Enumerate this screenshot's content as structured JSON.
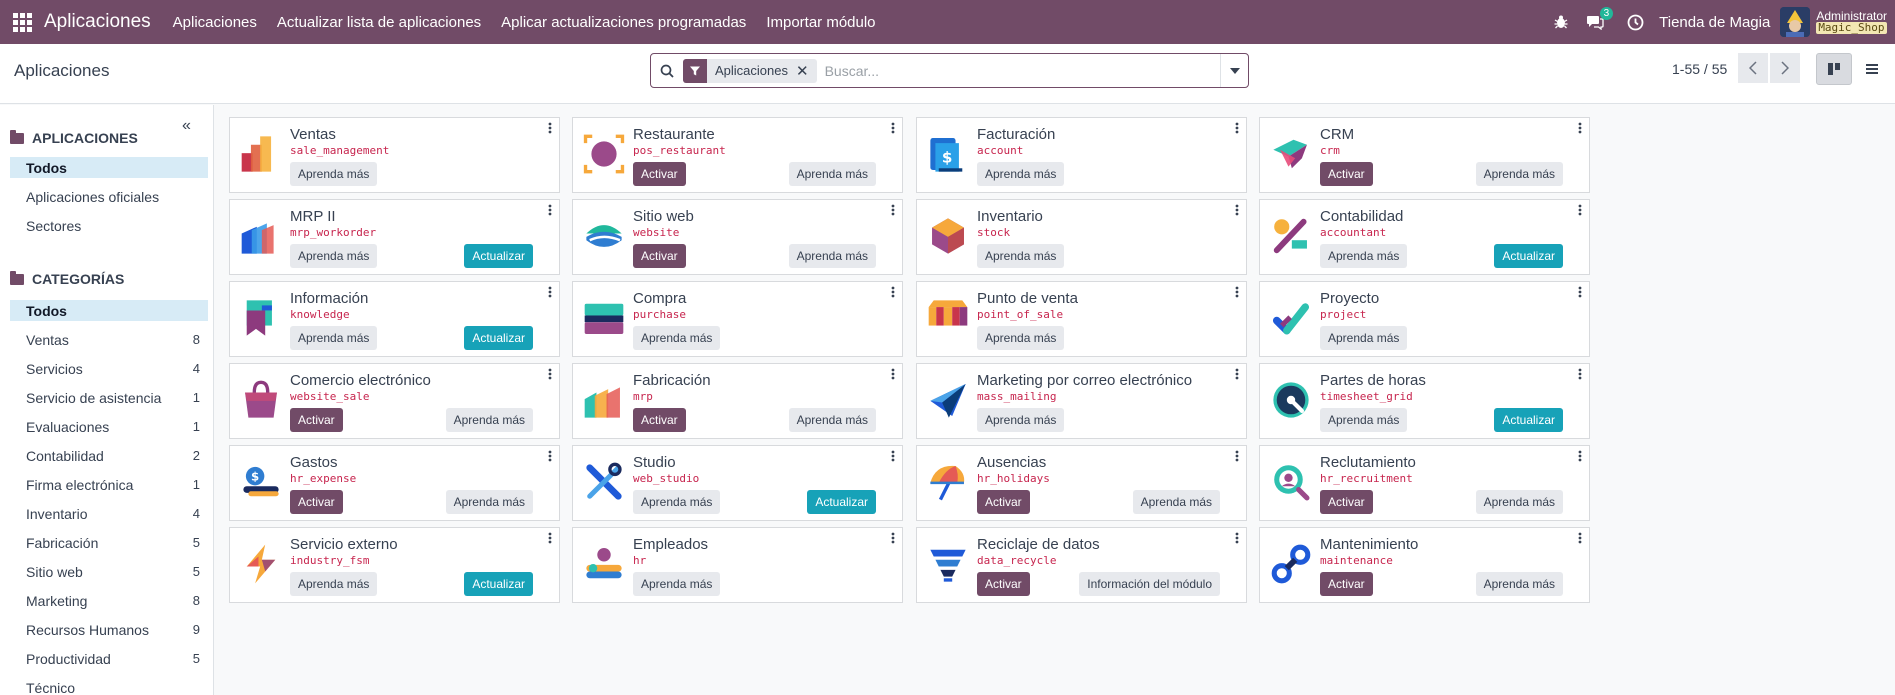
{
  "navbar": {
    "brand": "Aplicaciones",
    "menus": [
      "Aplicaciones",
      "Actualizar lista de aplicaciones",
      "Aplicar actualizaciones programadas",
      "Importar módulo"
    ],
    "chat_badge": "3",
    "company": "Tienda de Magia",
    "user": "Administrator",
    "database": "Magic_Shop",
    "icons": [
      "apps-grid-icon",
      "bug-icon",
      "chat-icon",
      "clock-icon"
    ]
  },
  "control": {
    "title": "Aplicaciones",
    "facet": "Aplicaciones",
    "search_placeholder": "Buscar...",
    "pager": "1-55 / 55"
  },
  "sidebar": {
    "apps_title": "APLICACIONES",
    "apps_items": [
      "Todos",
      "Aplicaciones oficiales",
      "Sectores"
    ],
    "cat_title": "CATEGORÍAS",
    "cat_items": [
      {
        "label": "Todos",
        "count": ""
      },
      {
        "label": "Ventas",
        "count": "8"
      },
      {
        "label": "Servicios",
        "count": "4"
      },
      {
        "label": "Servicio de asistencia",
        "count": "1"
      },
      {
        "label": "Evaluaciones",
        "count": "1"
      },
      {
        "label": "Contabilidad",
        "count": "2"
      },
      {
        "label": "Firma electrónica",
        "count": "1"
      },
      {
        "label": "Inventario",
        "count": "4"
      },
      {
        "label": "Fabricación",
        "count": "5"
      },
      {
        "label": "Sitio web",
        "count": "5"
      },
      {
        "label": "Marketing",
        "count": "8"
      },
      {
        "label": "Recursos Humanos",
        "count": "9"
      },
      {
        "label": "Productividad",
        "count": "5"
      },
      {
        "label": "Técnico",
        "count": ""
      }
    ]
  },
  "labels": {
    "activate": "Activar",
    "learn": "Aprenda más",
    "update": "Actualizar",
    "module_info": "Información del módulo"
  },
  "apps": [
    {
      "name": "Ventas",
      "tech": "sale_management",
      "logo": "sales-logo-icon",
      "buttons": [
        "learn"
      ]
    },
    {
      "name": "Restaurante",
      "tech": "pos_restaurant",
      "logo": "restaurant-logo-icon",
      "buttons": [
        "activate",
        "learn"
      ]
    },
    {
      "name": "Facturación",
      "tech": "account",
      "logo": "invoicing-logo-icon",
      "buttons": [
        "learn"
      ]
    },
    {
      "name": "CRM",
      "tech": "crm",
      "logo": "crm-logo-icon",
      "buttons": [
        "activate",
        "learn"
      ]
    },
    {
      "name": "MRP II",
      "tech": "mrp_workorder",
      "logo": "mrp-logo-icon",
      "buttons": [
        "learn",
        "update"
      ]
    },
    {
      "name": "Sitio web",
      "tech": "website",
      "logo": "website-logo-icon",
      "buttons": [
        "activate",
        "learn"
      ]
    },
    {
      "name": "Inventario",
      "tech": "stock",
      "logo": "inventory-logo-icon",
      "buttons": [
        "learn"
      ]
    },
    {
      "name": "Contabilidad",
      "tech": "accountant",
      "logo": "accounting-logo-icon",
      "buttons": [
        "learn",
        "update"
      ]
    },
    {
      "name": "Información",
      "tech": "knowledge",
      "logo": "knowledge-logo-icon",
      "buttons": [
        "learn",
        "update"
      ]
    },
    {
      "name": "Compra",
      "tech": "purchase",
      "logo": "purchase-logo-icon",
      "buttons": [
        "learn"
      ]
    },
    {
      "name": "Punto de venta",
      "tech": "point_of_sale",
      "logo": "pos-logo-icon",
      "buttons": [
        "learn"
      ]
    },
    {
      "name": "Proyecto",
      "tech": "project",
      "logo": "project-logo-icon",
      "buttons": [
        "learn"
      ]
    },
    {
      "name": "Comercio electrónico",
      "tech": "website_sale",
      "logo": "ecommerce-logo-icon",
      "buttons": [
        "activate",
        "learn"
      ]
    },
    {
      "name": "Fabricación",
      "tech": "mrp",
      "logo": "manufacturing-logo-icon",
      "buttons": [
        "activate",
        "learn"
      ]
    },
    {
      "name": "Marketing por correo electrónico",
      "tech": "mass_mailing",
      "logo": "email-marketing-logo-icon",
      "buttons": [
        "learn"
      ]
    },
    {
      "name": "Partes de horas",
      "tech": "timesheet_grid",
      "logo": "timesheet-logo-icon",
      "buttons": [
        "learn",
        "update"
      ]
    },
    {
      "name": "Gastos",
      "tech": "hr_expense",
      "logo": "expenses-logo-icon",
      "buttons": [
        "activate",
        "learn"
      ]
    },
    {
      "name": "Studio",
      "tech": "web_studio",
      "logo": "studio-logo-icon",
      "buttons": [
        "learn",
        "update"
      ]
    },
    {
      "name": "Ausencias",
      "tech": "hr_holidays",
      "logo": "time-off-logo-icon",
      "buttons": [
        "activate",
        "learn"
      ]
    },
    {
      "name": "Reclutamiento",
      "tech": "hr_recruitment",
      "logo": "recruitment-logo-icon",
      "buttons": [
        "activate",
        "learn"
      ]
    },
    {
      "name": "Servicio externo",
      "tech": "industry_fsm",
      "logo": "field-service-logo-icon",
      "buttons": [
        "learn",
        "update"
      ]
    },
    {
      "name": "Empleados",
      "tech": "hr",
      "logo": "employees-logo-icon",
      "buttons": [
        "learn"
      ]
    },
    {
      "name": "Reciclaje de datos",
      "tech": "data_recycle",
      "logo": "data-recycle-logo-icon",
      "buttons": [
        "activate",
        "module_info"
      ]
    },
    {
      "name": "Mantenimiento",
      "tech": "maintenance",
      "logo": "maintenance-logo-icon",
      "buttons": [
        "activate",
        "learn"
      ]
    }
  ]
}
